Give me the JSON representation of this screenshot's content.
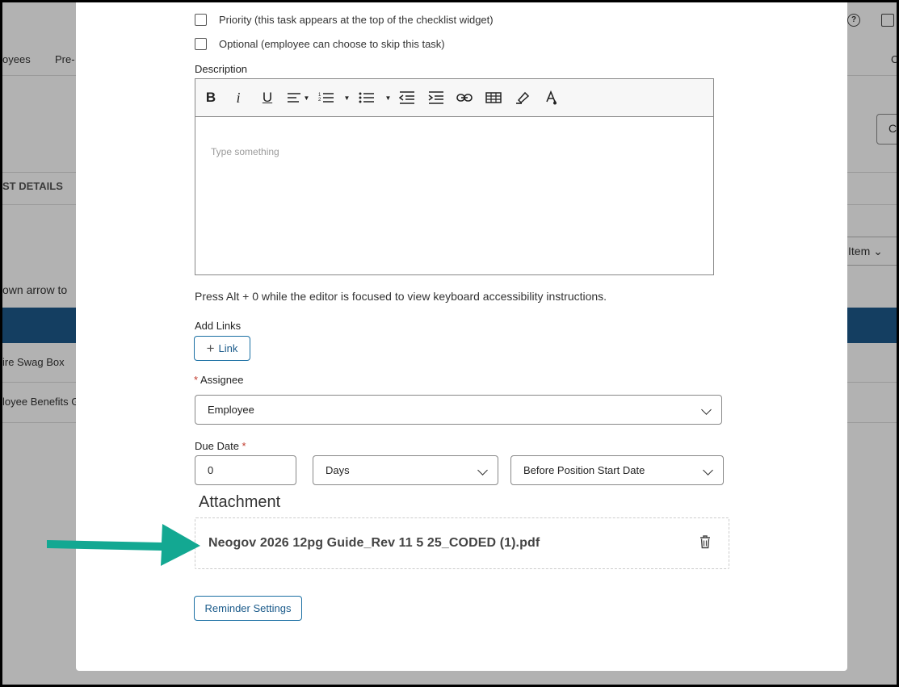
{
  "background": {
    "nav_items": [
      "oyees",
      "Pre-"
    ],
    "right_nav_partial": "C",
    "right_button_partial": "C",
    "section_tab": "ST DETAILS",
    "item_button_label": "Item",
    "instruction_partial": "own arrow to",
    "rows": [
      "ire Swag Box",
      "loyee Benefits G"
    ]
  },
  "modal": {
    "priority_label": "Priority (this task appears at the top of the checklist widget)",
    "optional_label": "Optional (employee can choose to skip this task)",
    "description_label": "Description",
    "editor_placeholder": "Type something",
    "toolbar": {
      "bold": "B",
      "italic": "i",
      "underline": "U"
    },
    "editor_help": "Press Alt + 0 while the editor is focused to view keyboard accessibility instructions.",
    "add_links_label": "Add Links",
    "link_button": "Link",
    "assignee_label": "Assignee",
    "assignee_value": "Employee",
    "due_date_label": "Due Date",
    "due_amount": "0",
    "due_unit": "Days",
    "due_relation": "Before Position Start Date",
    "attachment_title": "Attachment",
    "attachment_file": "Neogov 2026 12pg Guide_Rev 11 5 25_CODED (1).pdf",
    "reminder_button": "Reminder Settings"
  },
  "colors": {
    "arrow": "#13a892",
    "primary_button": "#1a6fa3",
    "band": "#1d5a8c",
    "required": "#c0392b"
  }
}
